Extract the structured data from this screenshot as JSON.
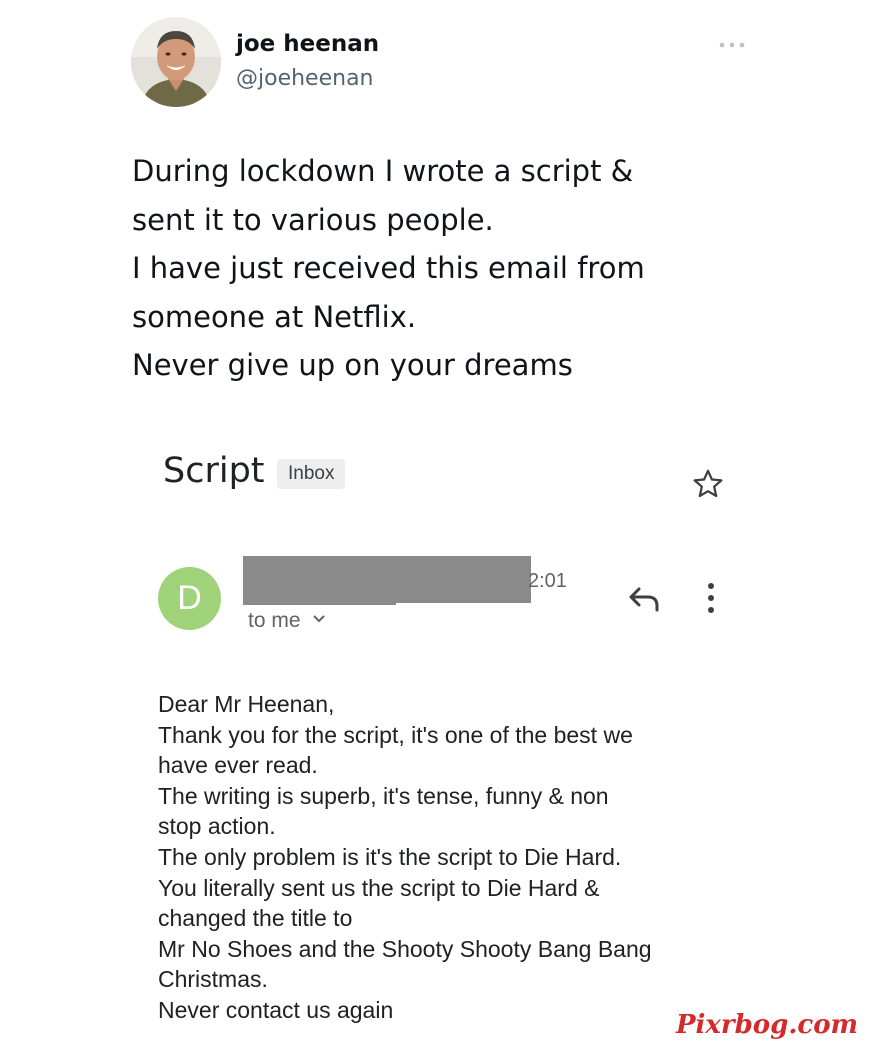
{
  "tweet": {
    "author": {
      "name": "joe heenan",
      "handle": "@joeheenan",
      "avatar_icon": "profile-photo"
    },
    "more_icon": "more-horizontal-icon",
    "text_lines": [
      "During lockdown I wrote a script &",
      "sent it to various people.",
      "I have just received this email from",
      "someone at Netflix.",
      "Never give up on your dreams"
    ]
  },
  "email": {
    "subject": "Script",
    "label": "Inbox",
    "star_icon": "star-outline-icon",
    "sender_initial": "D",
    "sender_avatar_color": "#a0d27a",
    "time_partial": "2:01",
    "recipient": "to me",
    "reply_icon": "reply-icon",
    "more_icon": "more-vertical-icon",
    "body_lines": [
      "Dear Mr Heenan,",
      "Thank you for the script, it's one of the best we",
      "have ever read.",
      "The writing is superb, it's tense, funny & non",
      "stop action.",
      "The only problem is it's the script to Die Hard.",
      "You literally sent us the script to Die Hard &",
      "changed the title to",
      "Mr No Shoes and the Shooty Shooty Bang Bang",
      "Christmas.",
      "Never contact us again"
    ]
  },
  "watermark": "Pixrbog.com",
  "colors": {
    "text_primary": "#0f1419",
    "text_secondary": "#536471",
    "redaction": "#8a8a8a",
    "watermark": "#d42a2a"
  }
}
